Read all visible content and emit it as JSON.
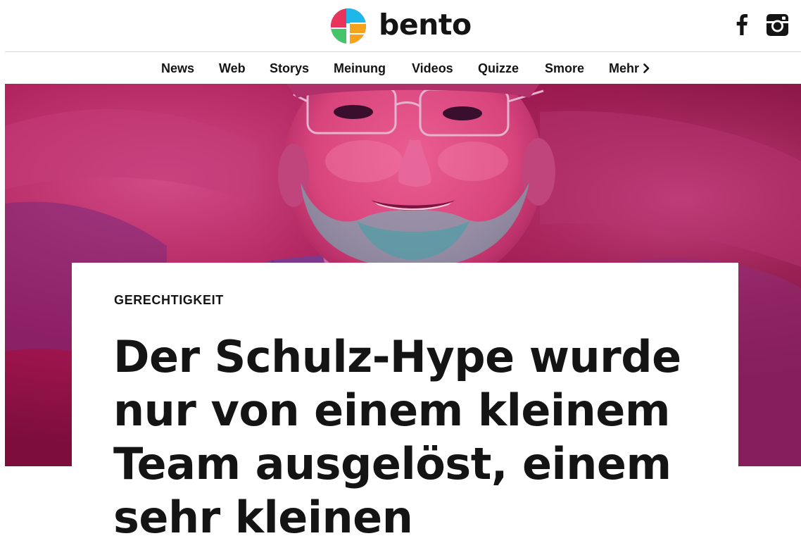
{
  "brand": {
    "name": "bento",
    "logo_colors": [
      "#e8345a",
      "#1fb7e8",
      "#f7a21b",
      "#8e44d6"
    ]
  },
  "social": {
    "facebook_icon": "facebook-icon",
    "instagram_icon": "instagram-icon"
  },
  "nav": {
    "items": [
      {
        "label": "News"
      },
      {
        "label": "Web"
      },
      {
        "label": "Storys"
      },
      {
        "label": "Meinung"
      },
      {
        "label": "Videos"
      },
      {
        "label": "Quizze"
      },
      {
        "label": "Smore"
      },
      {
        "label": "Mehr",
        "icon": "chevron-right-icon"
      }
    ]
  },
  "article": {
    "kicker": "GERECHTIGKEIT",
    "headline": "Der Schulz-Hype wurde nur von einem kleinem Team ausgelöst, einem sehr kleinen"
  },
  "colors": {
    "hero_tint": "#c2185b",
    "text": "#141414"
  }
}
